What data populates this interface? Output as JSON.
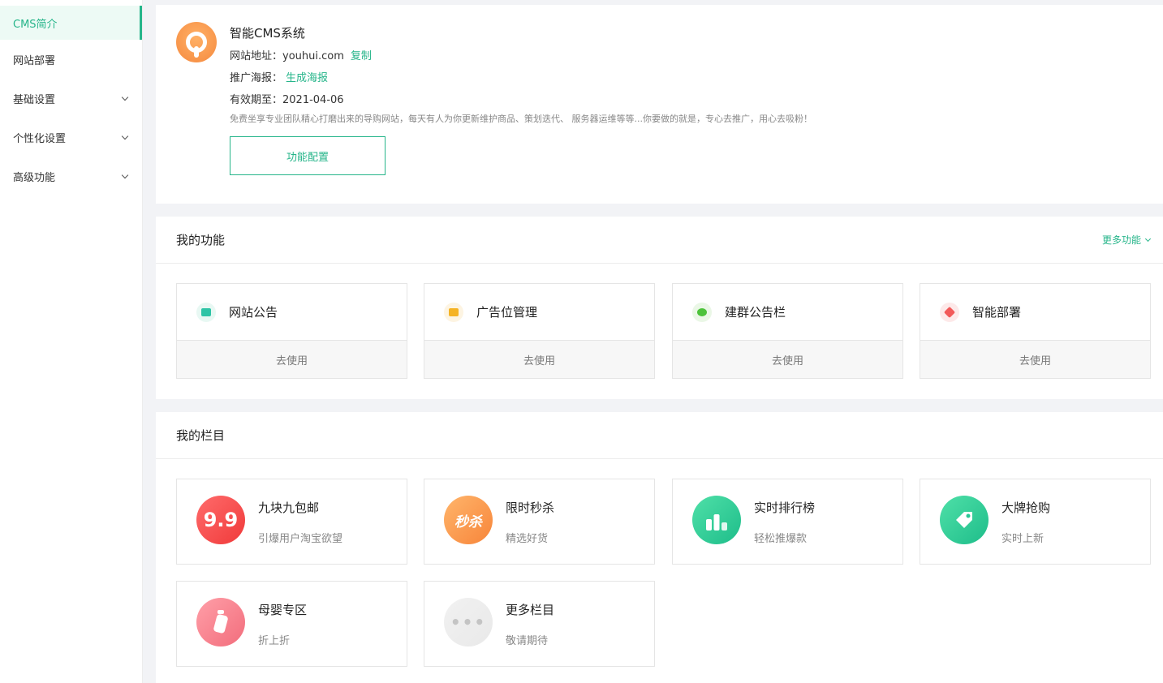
{
  "sidebar": {
    "items": [
      {
        "label": "CMS简介",
        "active": true
      },
      {
        "label": "网站部署"
      },
      {
        "label": "基础设置",
        "expandable": true
      },
      {
        "label": "个性化设置",
        "expandable": true
      },
      {
        "label": "高级功能",
        "expandable": true
      }
    ]
  },
  "info": {
    "title": "智能CMS系统",
    "site_label": "网站地址：",
    "site_value": "youhui.com",
    "copy_link": "复制",
    "poster_label": "推广海报：",
    "poster_link": "生成海报",
    "expire_label": "有效期至：",
    "expire_value": "2021-04-06",
    "description": "免费坐享专业团队精心打磨出来的导购网站，每天有人为你更新维护商品、策划迭代、 服务器运维等等...你要做的就是，专心去推广，用心去吸粉！",
    "config_button": "功能配置"
  },
  "functions": {
    "title": "我的功能",
    "more": "更多功能",
    "items": [
      {
        "name": "网站公告",
        "action": "去使用",
        "icon": "notice-book-icon",
        "color": "#2ec4a6",
        "bg": "#e8f8f3"
      },
      {
        "name": "广告位管理",
        "action": "去使用",
        "icon": "ad-board-icon",
        "color": "#f5b324",
        "bg": "#fdf4e2"
      },
      {
        "name": "建群公告栏",
        "action": "去使用",
        "icon": "wechat-group-icon",
        "color": "#4cc23a",
        "bg": "#eaf7e6"
      },
      {
        "name": "智能部署",
        "action": "去使用",
        "icon": "deploy-box-icon",
        "color": "#f25a5a",
        "bg": "#fde9e9"
      }
    ]
  },
  "columns": {
    "title": "我的栏目",
    "items": [
      {
        "name": "九块九包邮",
        "sub": "引爆用户淘宝欲望",
        "icon_text": "9.9",
        "icon": "nine-nine-icon",
        "gradient": "linear-gradient(135deg,#ff6b6b,#f03a3a)"
      },
      {
        "name": "限时秒杀",
        "sub": "精选好货",
        "icon_text": "秒杀",
        "icon": "flash-sale-icon",
        "gradient": "linear-gradient(135deg,#ffb56b,#f7853a)"
      },
      {
        "name": "实时排行榜",
        "sub": "轻松推爆款",
        "icon_text": "",
        "icon": "ranking-podium-icon",
        "gradient": "linear-gradient(135deg,#4fe0a8,#1ebd8a)"
      },
      {
        "name": "大牌抢购",
        "sub": "实时上新",
        "icon_text": "",
        "icon": "price-tag-icon",
        "gradient": "linear-gradient(135deg,#4fe0a8,#1ebd8a)"
      },
      {
        "name": "母婴专区",
        "sub": "折上折",
        "icon_text": "",
        "icon": "baby-bottle-icon",
        "gradient": "linear-gradient(135deg,#ff9fa8,#f26d7c)"
      },
      {
        "name": "更多栏目",
        "sub": "敬请期待",
        "icon_text": "•••",
        "icon": "more-dots-icon",
        "gradient": "linear-gradient(135deg,#f1f1f1,#e9e9e9)"
      }
    ]
  }
}
